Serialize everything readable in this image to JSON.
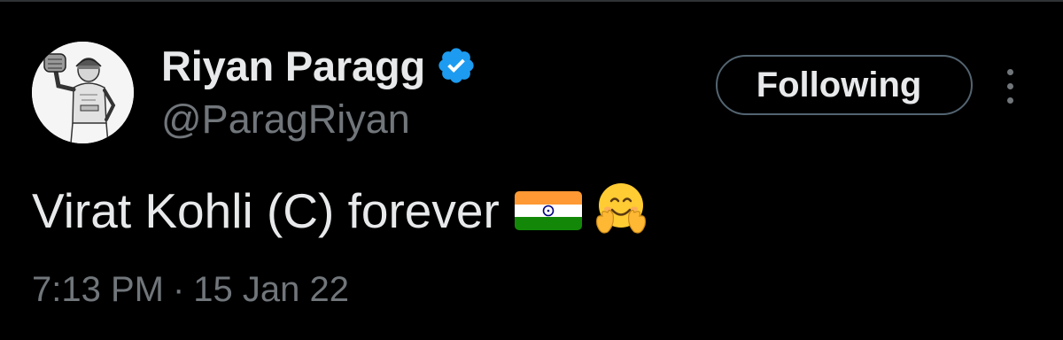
{
  "tweet": {
    "author": {
      "display_name": "Riyan Paragg",
      "handle": "@ParagRiyan",
      "verified_icon": "verified-badge-icon",
      "verified_color": "#1d9bf0"
    },
    "follow_button": {
      "label": "Following"
    },
    "more_icon": "more-vertical-icon",
    "text": "Virat Kohli (C) forever",
    "emojis": [
      "india-flag-icon",
      "hugging-face-icon"
    ],
    "time": "7:13 PM",
    "separator": "·",
    "date": "15 Jan 22"
  },
  "colors": {
    "background": "#000000",
    "primary_text": "#e7e9ea",
    "secondary_text": "#71767b",
    "button_border": "#536471"
  }
}
